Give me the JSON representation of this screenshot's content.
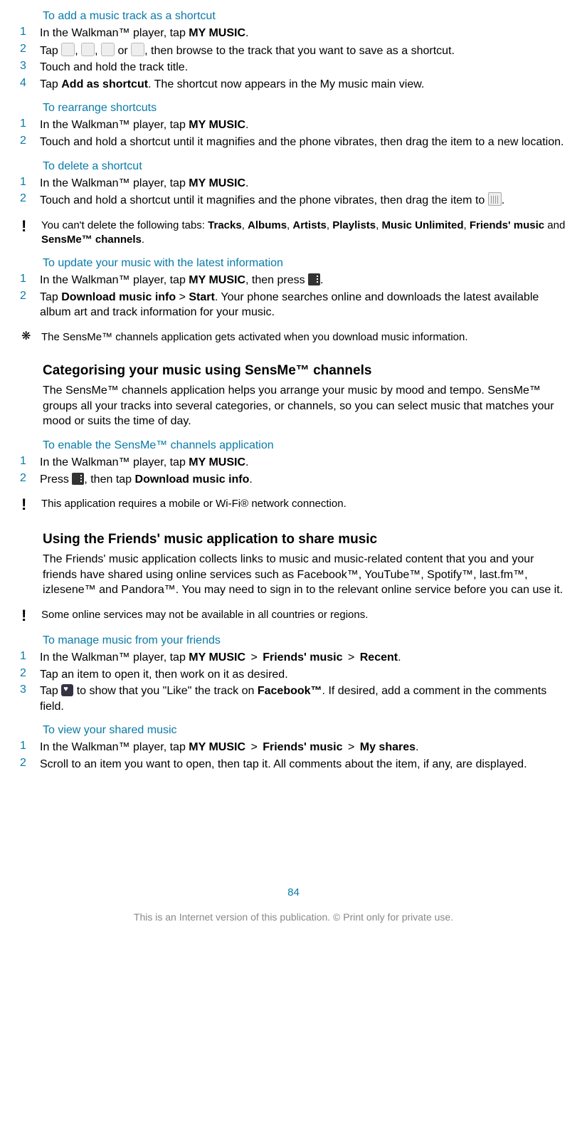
{
  "sections": {
    "addShortcut": {
      "title": "To add a music track as a shortcut",
      "steps": {
        "s1_pre": "In the Walkman™ player, tap ",
        "s1_b": "MY MUSIC",
        "s1_post": ".",
        "s2_pre": "Tap ",
        "s2_mid": " or ",
        "s2_post": ", then browse to the track that you want to save as a shortcut.",
        "s3": "Touch and hold the track title.",
        "s4_pre": "Tap ",
        "s4_b": "Add as shortcut",
        "s4_post": ". The shortcut now appears in the My music main view."
      }
    },
    "rearrange": {
      "title": "To rearrange shortcuts",
      "steps": {
        "s1_pre": "In the Walkman™ player, tap ",
        "s1_b": "MY MUSIC",
        "s1_post": ".",
        "s2": "Touch and hold a shortcut until it magnifies and the phone vibrates, then drag the item to a new location."
      }
    },
    "deleteShortcut": {
      "title": "To delete a shortcut",
      "steps": {
        "s1_pre": "In the Walkman™ player, tap ",
        "s1_b": "MY MUSIC",
        "s1_post": ".",
        "s2_pre": "Touch and hold a shortcut until it magnifies and the phone vibrates, then drag the item to ",
        "s2_post": "."
      },
      "note_pre": "You can't delete the following tabs: ",
      "note_b1": "Tracks",
      "note_b2": "Albums",
      "note_b3": "Artists",
      "note_b4": "Playlists",
      "note_b5": "Music Unlimited",
      "note_b6": "Friends' music",
      "note_and": " and ",
      "note_b7": "SensMe™ channels",
      "note_end": "."
    },
    "updateMusic": {
      "title": "To update your music with the latest information",
      "steps": {
        "s1_pre": "In the Walkman™ player, tap ",
        "s1_b": "MY MUSIC",
        "s1_mid": ", then press ",
        "s1_post": ".",
        "s2_pre": "Tap ",
        "s2_b1": "Download music info",
        "s2_gt": " > ",
        "s2_b2": "Start",
        "s2_post": ". Your phone searches online and downloads the latest available album art and track information for your music."
      },
      "tip": "The SensMe™ channels application gets activated when you download music information."
    },
    "categorising": {
      "heading": "Categorising your music using SensMe™ channels",
      "para": "The SensMe™ channels application helps you arrange your music by mood and tempo. SensMe™ groups all your tracks into several categories, or channels, so you can select music that matches your mood or suits the time of day."
    },
    "enableSensme": {
      "title": "To enable the SensMe™ channels application",
      "steps": {
        "s1_pre": "In the Walkman™ player, tap ",
        "s1_b": "MY MUSIC",
        "s1_post": ".",
        "s2_pre": "Press ",
        "s2_mid": ", then tap ",
        "s2_b": "Download music info",
        "s2_post": "."
      },
      "note": "This application requires a mobile or Wi-Fi® network connection."
    },
    "friendsMusic": {
      "heading": "Using the Friends' music application to share music",
      "para": "The Friends' music application collects links to music and music-related content that you and your friends have shared using online services such as Facebook™, YouTube™, Spotify™, last.fm™, izlesene™ and Pandora™. You may need to sign in to the relevant online service before you can use it.",
      "note": "Some online services may not be available in all countries or regions."
    },
    "manageFriends": {
      "title": "To manage music from your friends",
      "steps": {
        "s1_pre": "In the Walkman™ player, tap ",
        "s1_b1": "MY MUSIC",
        "s1_gt": " > ",
        "s1_b2": "Friends' music",
        "s1_b3": "Recent",
        "s1_post": ".",
        "s2": "Tap an item to open it, then work on it as desired.",
        "s3_pre": "Tap ",
        "s3_mid": " to show that you \"Like\" the track on ",
        "s3_b": "Facebook™",
        "s3_post": ". If desired, add a comment in the comments field."
      }
    },
    "viewShared": {
      "title": "To view your shared music",
      "steps": {
        "s1_pre": "In the Walkman™ player, tap ",
        "s1_b1": "MY MUSIC",
        "s1_gt": " > ",
        "s1_b2": "Friends' music",
        "s1_b3": "My shares",
        "s1_post": ".",
        "s2": "Scroll to an item you want to open, then tap it. All comments about the item, if any, are displayed."
      }
    }
  },
  "nums": {
    "n1": "1",
    "n2": "2",
    "n3": "3",
    "n4": "4"
  },
  "sep": {
    "comma": ", "
  },
  "footer": {
    "page": "84",
    "disclaimer": "This is an Internet version of this publication. © Print only for private use."
  }
}
